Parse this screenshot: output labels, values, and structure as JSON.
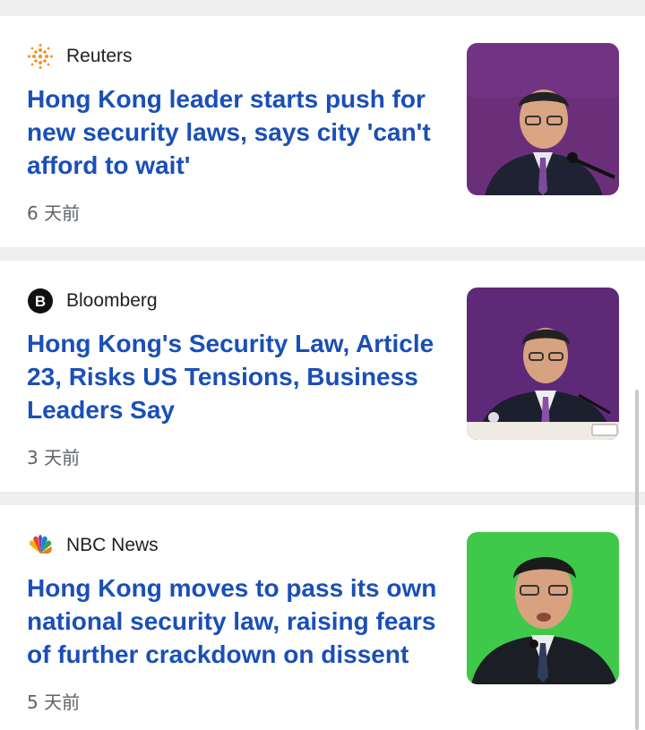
{
  "articles": [
    {
      "source": "Reuters",
      "logo_icon": "reuters-logo-icon",
      "headline": "Hong Kong leader starts push for new security laws, says city 'can't afford to wait'",
      "age": "6 天前",
      "thumb_bg": "#6b2f7a"
    },
    {
      "source": "Bloomberg",
      "logo_icon": "bloomberg-logo-icon",
      "headline": "Hong Kong's Security Law, Article 23, Risks US Tensions, Business Leaders Say",
      "age": "3 天前",
      "thumb_bg": "#5e2a78"
    },
    {
      "source": "NBC News",
      "logo_icon": "nbc-peacock-logo-icon",
      "headline": "Hong Kong moves to pass its own national security law, raising fears of further crackdown on dissent",
      "age": "5 天前",
      "thumb_bg": "#3fc94a"
    }
  ],
  "colors": {
    "headline": "#1a4fb8",
    "separator": "#eeeeee"
  }
}
